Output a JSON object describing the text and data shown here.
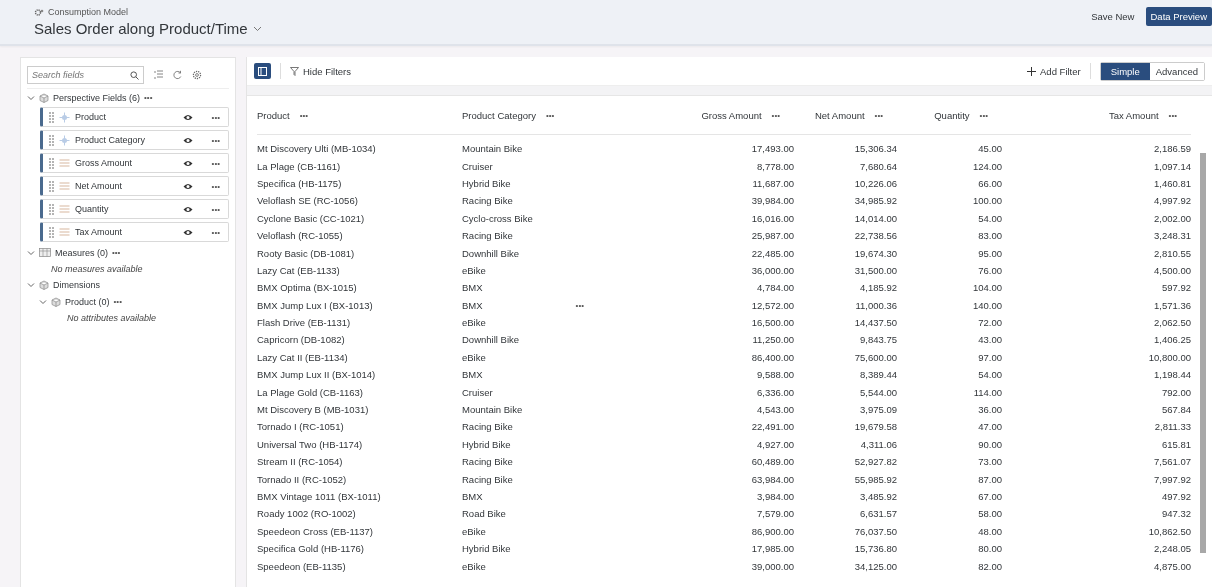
{
  "header": {
    "subtitle": "Consumption Model",
    "title": "Sales Order along Product/Time",
    "buttons": [
      {
        "label": "Save New",
        "kind": "plain"
      },
      {
        "label": "Data Preview",
        "kind": "primary"
      }
    ]
  },
  "sidebar": {
    "search": {
      "placeholder": "Search fields"
    },
    "perspective": {
      "label": "Perspective Fields (6)",
      "menu": "•••",
      "expanded": true,
      "fields": [
        {
          "label": "Product",
          "kind": "dimension",
          "menu": "•••"
        },
        {
          "label": "Product Category",
          "kind": "dimension",
          "menu": "•••"
        },
        {
          "label": "Gross Amount",
          "kind": "measure",
          "menu": "•••"
        },
        {
          "label": "Net Amount",
          "kind": "measure",
          "menu": "•••"
        },
        {
          "label": "Quantity",
          "kind": "measure",
          "menu": "•••"
        },
        {
          "label": "Tax Amount",
          "kind": "measure",
          "menu": "•••"
        }
      ]
    },
    "measures": {
      "label": "Measures (0)",
      "menu": "•••",
      "expanded": true,
      "empty_text": "No measures available"
    },
    "dimensions": {
      "label": "Dimensions",
      "expanded": true,
      "children": [
        {
          "label": "Product (0)",
          "menu": "•••",
          "expanded": true,
          "empty_text": "No attributes available"
        }
      ]
    }
  },
  "toolbar": {
    "hide_filters": "Hide Filters",
    "add_filter": "Add Filter",
    "modes": [
      {
        "label": "Simple",
        "selected": true
      },
      {
        "label": "Advanced",
        "selected": false
      }
    ]
  },
  "table": {
    "columns": [
      {
        "label": "Product",
        "menu": "•••"
      },
      {
        "label": "Product Category",
        "menu": "•••"
      },
      {
        "label": "Gross Amount",
        "menu": "•••"
      },
      {
        "label": "Net Amount",
        "menu": "•••"
      },
      {
        "label": "Quantity",
        "menu": "•••"
      },
      {
        "label": "Tax Amount",
        "menu": "•••"
      }
    ],
    "rows": [
      {
        "cells": [
          "Mt Discovery Ulti (MB-1034)",
          "Mountain Bike",
          "17,493.00",
          "15,306.34",
          "45.00",
          "2,186.59"
        ]
      },
      {
        "cells": [
          "La Plage (CB-1161)",
          "Cruiser",
          "8,778.00",
          "7,680.64",
          "124.00",
          "1,097.14"
        ]
      },
      {
        "cells": [
          "Specifica (HB-1175)",
          "Hybrid Bike",
          "11,687.00",
          "10,226.06",
          "66.00",
          "1,460.81"
        ]
      },
      {
        "cells": [
          "Veloflash SE (RC-1056)",
          "Racing Bike",
          "39,984.00",
          "34,985.92",
          "100.00",
          "4,997.92"
        ]
      },
      {
        "cells": [
          "Cyclone Basic (CC-1021)",
          "Cyclo-cross Bike",
          "16,016.00",
          "14,014.00",
          "54.00",
          "2,002.00"
        ]
      },
      {
        "cells": [
          "Veloflash (RC-1055)",
          "Racing Bike",
          "25,987.00",
          "22,738.56",
          "83.00",
          "3,248.31"
        ]
      },
      {
        "cells": [
          "Rooty Basic (DB-1081)",
          "Downhill Bike",
          "22,485.00",
          "19,674.30",
          "95.00",
          "2,810.55"
        ]
      },
      {
        "cells": [
          "Lazy Cat (EB-1133)",
          "eBike",
          "36,000.00",
          "31,500.00",
          "76.00",
          "4,500.00"
        ]
      },
      {
        "cells": [
          "BMX Optima (BX-1015)",
          "BMX",
          "4,784.00",
          "4,185.92",
          "104.00",
          "597.92"
        ]
      },
      {
        "cells": [
          "BMX Jump Lux I (BX-1013)",
          "BMX",
          "12,572.00",
          "11,000.36",
          "140.00",
          "1,571.36"
        ],
        "row_menu": "•••"
      },
      {
        "cells": [
          "Flash Drive (EB-1131)",
          "eBike",
          "16,500.00",
          "14,437.50",
          "72.00",
          "2,062.50"
        ]
      },
      {
        "cells": [
          "Capricorn (DB-1082)",
          "Downhill Bike",
          "11,250.00",
          "9,843.75",
          "43.00",
          "1,406.25"
        ]
      },
      {
        "cells": [
          "Lazy Cat II (EB-1134)",
          "eBike",
          "86,400.00",
          "75,600.00",
          "97.00",
          "10,800.00"
        ]
      },
      {
        "cells": [
          "BMX Jump Lux II (BX-1014)",
          "BMX",
          "9,588.00",
          "8,389.44",
          "54.00",
          "1,198.44"
        ]
      },
      {
        "cells": [
          "La Plage Gold (CB-1163)",
          "Cruiser",
          "6,336.00",
          "5,544.00",
          "114.00",
          "792.00"
        ]
      },
      {
        "cells": [
          "Mt Discovery B (MB-1031)",
          "Mountain Bike",
          "4,543.00",
          "3,975.09",
          "36.00",
          "567.84"
        ]
      },
      {
        "cells": [
          "Tornado I (RC-1051)",
          "Racing Bike",
          "22,491.00",
          "19,679.58",
          "47.00",
          "2,811.33"
        ]
      },
      {
        "cells": [
          "Universal Two (HB-1174)",
          "Hybrid Bike",
          "4,927.00",
          "4,311.06",
          "90.00",
          "615.81"
        ]
      },
      {
        "cells": [
          "Stream II (RC-1054)",
          "Racing Bike",
          "60,489.00",
          "52,927.82",
          "73.00",
          "7,561.07"
        ]
      },
      {
        "cells": [
          "Tornado II (RC-1052)",
          "Racing Bike",
          "63,984.00",
          "55,985.92",
          "87.00",
          "7,997.92"
        ]
      },
      {
        "cells": [
          "BMX Vintage 1011 (BX-1011)",
          "BMX",
          "3,984.00",
          "3,485.92",
          "67.00",
          "497.92"
        ]
      },
      {
        "cells": [
          "Roady 1002 (RO-1002)",
          "Road Bike",
          "7,579.00",
          "6,631.57",
          "58.00",
          "947.32"
        ]
      },
      {
        "cells": [
          "Speedeon Cross (EB-1137)",
          "eBike",
          "86,900.00",
          "76,037.50",
          "48.00",
          "10,862.50"
        ]
      },
      {
        "cells": [
          "Specifica Gold (HB-1176)",
          "Hybrid Bike",
          "17,985.00",
          "15,736.80",
          "80.00",
          "2,248.05"
        ]
      },
      {
        "cells": [
          "Speedeon (EB-1135)",
          "eBike",
          "39,000.00",
          "34,125.00",
          "82.00",
          "4,875.00"
        ]
      }
    ]
  }
}
